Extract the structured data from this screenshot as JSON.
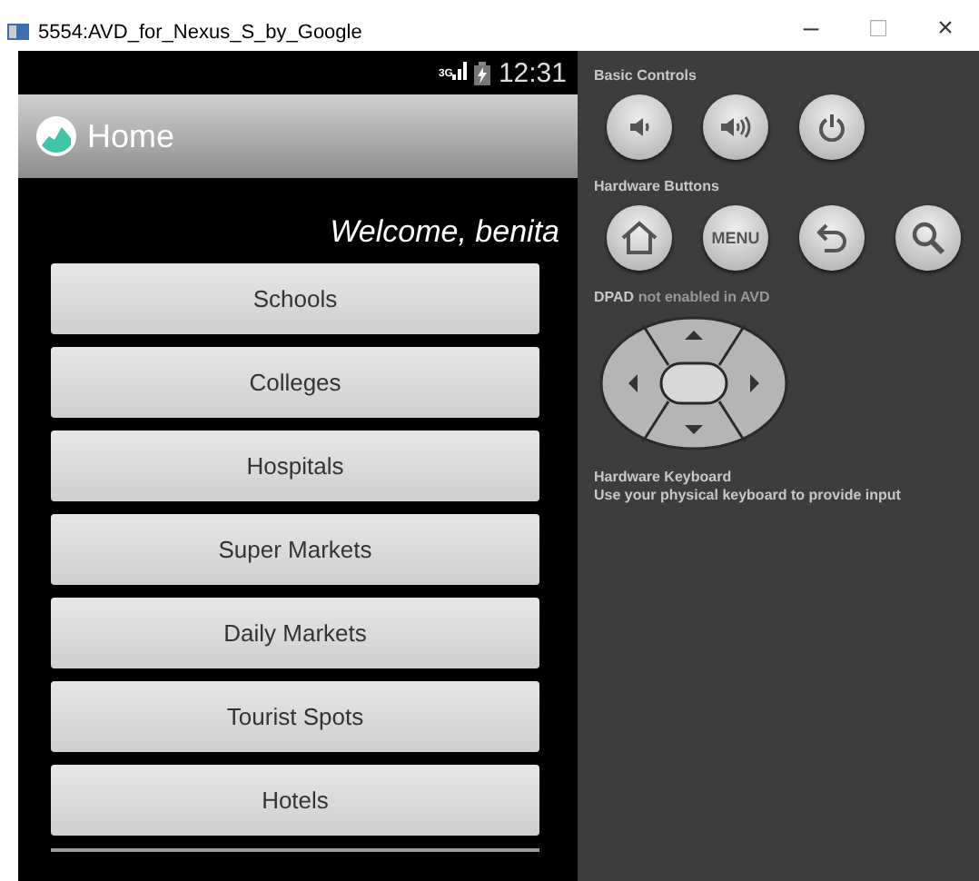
{
  "window": {
    "title": "5554:AVD_for_Nexus_S_by_Google",
    "controls": [
      "–",
      "□",
      "×"
    ]
  },
  "status_bar": {
    "network": "3G",
    "time": "12:31"
  },
  "action_bar": {
    "title": "Home"
  },
  "welcome": "Welcome, benita",
  "menu_buttons": [
    "Schools",
    "Colleges",
    "Hospitals",
    "Super Markets",
    "Daily Markets",
    "Tourist Spots",
    "Hotels"
  ],
  "controls_panel": {
    "basic_controls": {
      "title": "Basic Controls",
      "buttons": [
        {
          "kind": "volume-down"
        },
        {
          "kind": "volume-up"
        },
        {
          "kind": "power"
        }
      ]
    },
    "hardware_buttons": {
      "title": "Hardware Buttons",
      "buttons": [
        {
          "kind": "home"
        },
        {
          "kind": "menu",
          "label": "MENU"
        },
        {
          "kind": "back"
        },
        {
          "kind": "search"
        }
      ]
    },
    "dpad": {
      "title": "DPAD",
      "note": "not enabled in AVD"
    },
    "keyboard": {
      "title": "Hardware Keyboard",
      "note": "Use your physical keyboard to provide input"
    }
  }
}
